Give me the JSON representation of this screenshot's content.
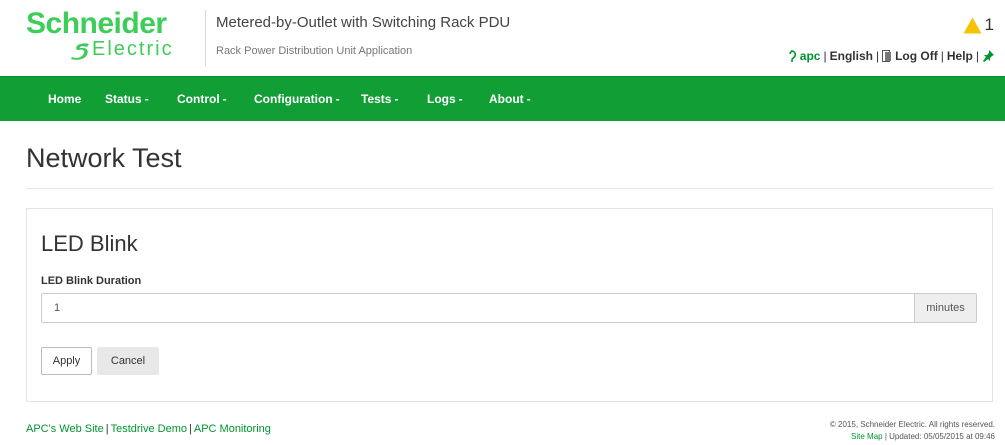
{
  "brand": {
    "name_top": "Schneider",
    "name_bottom": "Electric",
    "green": "#3dcd58"
  },
  "header": {
    "product_title": "Metered-by-Outlet with Switching Rack PDU",
    "product_subtitle": "Rack Power Distribution Unit Application",
    "alert_icon": "warning-triangle-icon",
    "alert_count": "1",
    "user": "apc",
    "language": "English",
    "logoff": "Log Off",
    "help": "Help",
    "pin_icon": "pin-icon"
  },
  "nav": {
    "background": "#119e35",
    "items": [
      {
        "label": "Home",
        "dropdown": false
      },
      {
        "label": "Status",
        "dropdown": true
      },
      {
        "label": "Control",
        "dropdown": true
      },
      {
        "label": "Configuration",
        "dropdown": true
      },
      {
        "label": "Tests",
        "dropdown": true
      },
      {
        "label": "Logs",
        "dropdown": true
      },
      {
        "label": "About",
        "dropdown": true
      }
    ],
    "caret": "-"
  },
  "page": {
    "title": "Network Test"
  },
  "panel": {
    "title": "LED Blink",
    "field_label": "LED Blink Duration",
    "duration_value": "1",
    "unit": "minutes",
    "apply_label": "Apply",
    "cancel_label": "Cancel"
  },
  "footer": {
    "links": [
      "APC's Web Site",
      "Testdrive Demo",
      "APC Monitoring"
    ],
    "copyright": "© 2015, Schneider Electric. All rights reserved.",
    "site_map": "Site Map",
    "updated": "Updated: 05/05/2015 at 09:46"
  }
}
